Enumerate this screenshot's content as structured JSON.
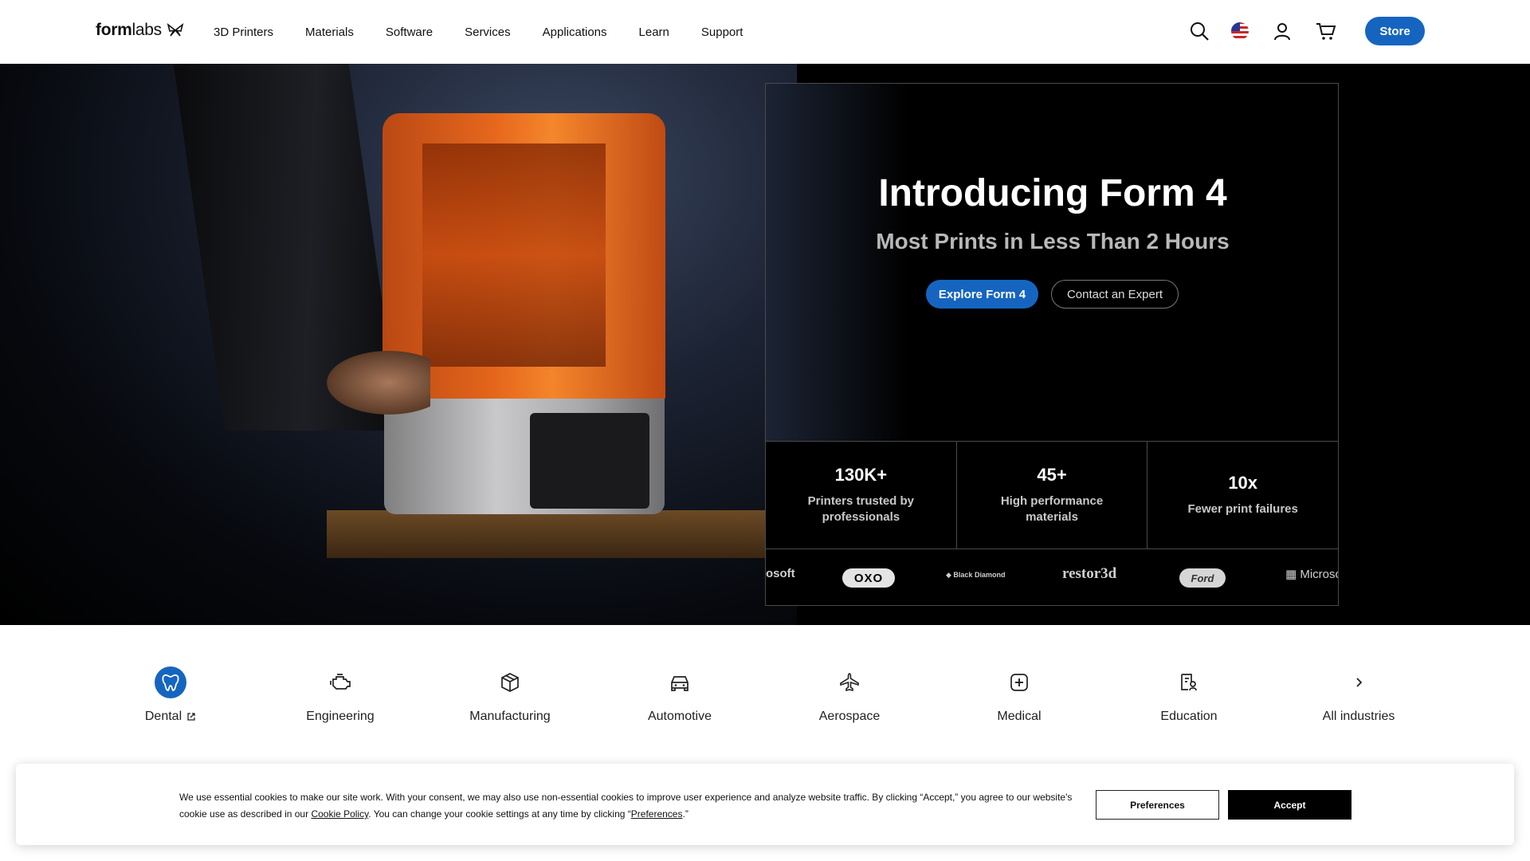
{
  "header": {
    "logo_bold": "form",
    "logo_light": "labs",
    "nav": [
      {
        "label": "3D Printers"
      },
      {
        "label": "Materials"
      },
      {
        "label": "Software"
      },
      {
        "label": "Services"
      },
      {
        "label": "Applications"
      },
      {
        "label": "Learn"
      },
      {
        "label": "Support"
      }
    ],
    "icons": [
      "search-icon",
      "us-flag-icon",
      "user-icon",
      "cart-icon"
    ],
    "store_label": "Store"
  },
  "hero": {
    "title": "Introducing Form 4",
    "subtitle": "Most Prints in Less Than 2 Hours",
    "primary_cta": "Explore Form 4",
    "secondary_cta": "Contact an Expert",
    "stats": [
      {
        "value": "130K+",
        "label": "Printers trusted by professionals"
      },
      {
        "value": "45+",
        "label": "High performance materials"
      },
      {
        "value": "10x",
        "label": "Fewer print failures"
      }
    ],
    "logos": [
      {
        "name": "osoft"
      },
      {
        "name": "OXO"
      },
      {
        "name": "Black Diamond"
      },
      {
        "name": "restor3d"
      },
      {
        "name": "Ford"
      },
      {
        "name": "Microso"
      }
    ]
  },
  "industries": [
    {
      "label": "Dental",
      "icon": "tooth-icon",
      "active": true,
      "external": true
    },
    {
      "label": "Engineering",
      "icon": "engine-icon"
    },
    {
      "label": "Manufacturing",
      "icon": "box-icon"
    },
    {
      "label": "Automotive",
      "icon": "car-icon"
    },
    {
      "label": "Aerospace",
      "icon": "airplane-icon"
    },
    {
      "label": "Medical",
      "icon": "medical-cross-icon"
    },
    {
      "label": "Education",
      "icon": "education-icon"
    },
    {
      "label": "All industries",
      "icon": "chevron-right-icon"
    }
  ],
  "cookie": {
    "text_1": "We use essential cookies to make our site work. With your consent, we may also use non-essential cookies to improve user experience and analyze website traffic. By clicking “Accept,” you agree to our website's cookie use as described in our ",
    "policy_link": "Cookie Policy",
    "text_2": ". You can change your cookie settings at any time by clicking “",
    "preferences_link": "Preferences",
    "text_3": ".”",
    "preferences_button": "Preferences",
    "accept_button": "Accept"
  },
  "colors": {
    "accent": "#1565c0",
    "hero_bg": "#000000",
    "printer_orange": "#f06a1a"
  }
}
